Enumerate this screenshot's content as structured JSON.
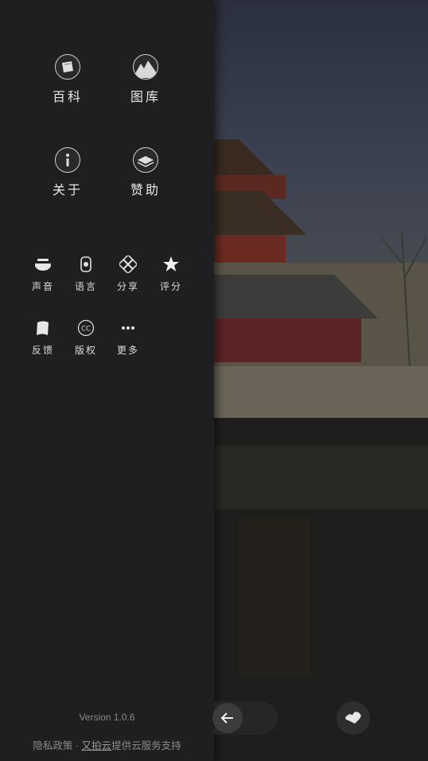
{
  "menu_main": [
    {
      "label": "百科",
      "icon": "encyclopedia-icon"
    },
    {
      "label": "图库",
      "icon": "gallery-icon"
    },
    {
      "label": "关于",
      "icon": "info-icon"
    },
    {
      "label": "赞助",
      "icon": "sponsor-icon"
    }
  ],
  "menu_secondary": [
    {
      "label": "声音",
      "icon": "sound-icon"
    },
    {
      "label": "语言",
      "icon": "language-icon"
    },
    {
      "label": "分享",
      "icon": "share-icon"
    },
    {
      "label": "评分",
      "icon": "star-icon"
    },
    {
      "label": "反馈",
      "icon": "feedback-icon"
    },
    {
      "label": "版权",
      "icon": "copyright-icon"
    },
    {
      "label": "更多",
      "icon": "more-icon"
    }
  ],
  "version": "Version 1.0.6",
  "footer": {
    "privacy": "隐私政策",
    "separator": " · ",
    "provider_link": "又拍云",
    "provider_suffix": "提供云服务支持"
  },
  "colors": {
    "drawer_bg": "#1f1f21",
    "text": "#e8e8e8",
    "muted": "#8a8a8a"
  }
}
